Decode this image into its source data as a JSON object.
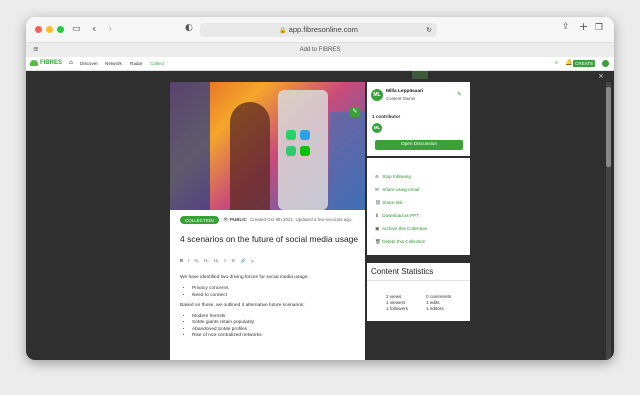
{
  "browser": {
    "url": "app.fibresonline.com",
    "tab_title": "Add to FIBRES"
  },
  "appnav": {
    "brand": "FIBRES",
    "items": [
      "Discover",
      "Network",
      "Radar",
      "Collect"
    ],
    "create_label": "CREATE"
  },
  "collection": {
    "badge": "COLLECTION",
    "visibility": "PUBLIC",
    "meta": "Created Oct 8th 2021, Updated a few seconds ago.",
    "title": "4 scenarios on the future of social media usage",
    "toolbar": [
      "B",
      "I",
      "H₁",
      "H₂",
      "H₃",
      "≡",
      "☰",
      "🔗",
      "↳"
    ],
    "intro": "We have identified two driving forces for social media usage:",
    "forces": [
      "Privacy concerns",
      "Need to connect"
    ],
    "scenarios_intro": "Based on those, we outlined 4 alternative future scenarios:",
    "scenarios": [
      "Modern hermits",
      "SoMe giants retain popularity",
      "Abandoned SoMe profiles",
      "Rise of non-centralized networks"
    ]
  },
  "owner": {
    "initials": "ML",
    "name": "Milla Leppäsaari",
    "role": "Content Owner",
    "contributors_label": "1 contributor",
    "contributor_initials": "ML",
    "open_discussion": "Open Discussion"
  },
  "actions": [
    {
      "icon": "person-minus-icon",
      "glyph": "⊖",
      "label": "Stop following"
    },
    {
      "icon": "email-icon",
      "glyph": "✉",
      "label": "Share using email"
    },
    {
      "icon": "link-icon",
      "glyph": "⛓",
      "label": "Share link"
    },
    {
      "icon": "download-icon",
      "glyph": "⬇",
      "label": "Download as PPT"
    },
    {
      "icon": "archive-icon",
      "glyph": "▣",
      "label": "Archive this Collection"
    },
    {
      "icon": "trash-icon",
      "glyph": "🗑",
      "label": "Delete this Collection"
    }
  ],
  "stats": {
    "title": "Content Statistics",
    "views": "2 views",
    "viewers": "1 viewers",
    "followers": "1 followers",
    "comments": "0 comments",
    "edits": "1 edits",
    "editors": "1 editors"
  },
  "colors": {
    "accent": "#3aa03a",
    "overlay": "#2f2f2f"
  }
}
